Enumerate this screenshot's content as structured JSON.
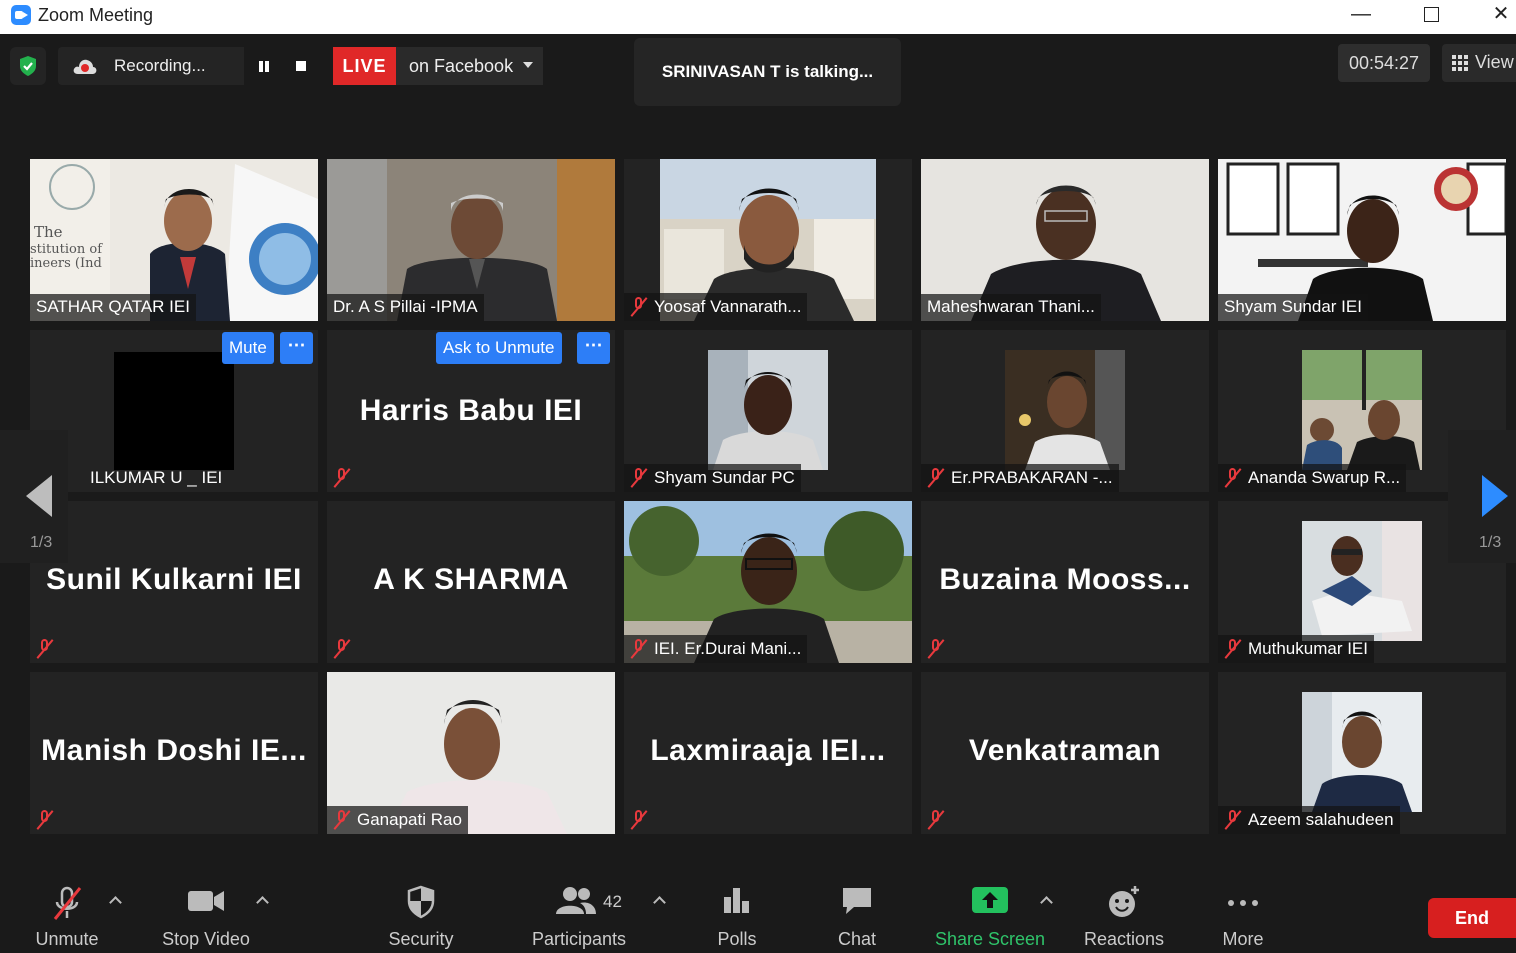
{
  "window": {
    "title": "Zoom Meeting"
  },
  "topbar": {
    "recording_label": "Recording...",
    "live_label": "LIVE",
    "stream_target": "on Facebook",
    "talking": "SRINIVASAN T is talking...",
    "timer": "00:54:27",
    "view_label": "View"
  },
  "tiles": [
    {
      "name": "SATHAR QATAR IEI"
    },
    {
      "name": "Dr. A S Pillai -IPMA"
    },
    {
      "name": "Yoosaf Vannarath..."
    },
    {
      "name": "Maheshwaran Thani..."
    },
    {
      "name": "Shyam Sundar IEI"
    },
    {
      "name": "ILKUMAR U _ IEI",
      "mute_button": "Mute",
      "more_button": "⋯"
    },
    {
      "name": "Harris Babu IEI",
      "unmute_button": "Ask to Unmute",
      "more_button": "⋯"
    },
    {
      "name": "Shyam Sundar PC"
    },
    {
      "name": "Er.PRABAKARAN -..."
    },
    {
      "name": "Ananda Swarup R..."
    },
    {
      "name": "Sunil Kulkarni IEI"
    },
    {
      "name": "A K SHARMA"
    },
    {
      "name": "IEI. Er.Durai Mani..."
    },
    {
      "name": "Buzaina  Mooss..."
    },
    {
      "name": "Muthukumar IEI"
    },
    {
      "name": "Manish  Doshi  IE..."
    },
    {
      "name": "Ganapati Rao"
    },
    {
      "name": "Laxmiraaja  IEI..."
    },
    {
      "name": "Venkatraman"
    },
    {
      "name": "Azeem salahudeen"
    }
  ],
  "pagination": {
    "left": "1/3",
    "right": "1/3"
  },
  "toolbar": {
    "unmute": "Unmute",
    "stop_video": "Stop Video",
    "security": "Security",
    "participants": "Participants",
    "participants_count": "42",
    "polls": "Polls",
    "chat": "Chat",
    "share_screen": "Share Screen",
    "reactions": "Reactions",
    "more": "More",
    "end": "End"
  },
  "colors": {
    "accent": "#2d8cff",
    "live": "#e02828",
    "end": "#d71f1f",
    "share": "#2fc36a",
    "muted": "#e8393d"
  }
}
